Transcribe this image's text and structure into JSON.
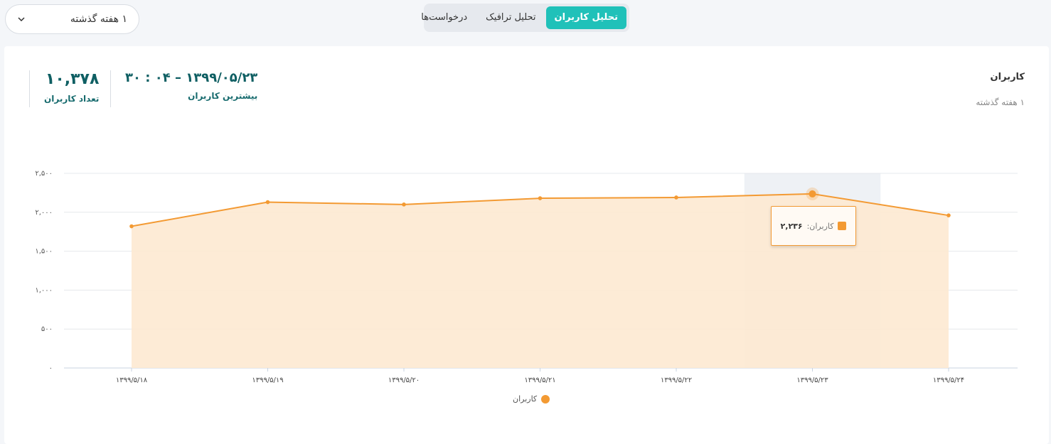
{
  "period_select": {
    "value": "۱ هفته گذشته"
  },
  "tabs": [
    {
      "label": "تحلیل کاربران",
      "active": true
    },
    {
      "label": "تحلیل ترافیک",
      "active": false
    },
    {
      "label": "درخواست‌ها",
      "active": false
    }
  ],
  "card": {
    "title": "کاربران",
    "subtitle": "۱ هفته گذشته",
    "peak": {
      "value": "۱۳۹۹/۰۵/۲۳ – ۰۴ : ۳۰",
      "label": "بیشترین کاربران"
    },
    "total": {
      "value": "۱۰,۳۷۸",
      "label": "تعداد کاربران"
    }
  },
  "tooltip": {
    "name": "کاربران:",
    "value": "۲,۲۳۶"
  },
  "colors": {
    "accent": "#20c1b9",
    "series": "#f39a33",
    "area": "#fde9d2",
    "highlight": "#eef1f5"
  },
  "chart_data": {
    "type": "area",
    "categories": [
      "۱۳۹۹/۵/۱۸",
      "۱۳۹۹/۵/۱۹",
      "۱۳۹۹/۵/۲۰",
      "۱۳۹۹/۵/۲۱",
      "۱۳۹۹/۵/۲۲",
      "۱۳۹۹/۵/۲۳",
      "۱۳۹۹/۵/۲۴"
    ],
    "series": [
      {
        "name": "کاربران",
        "values": [
          1820,
          2130,
          2100,
          2180,
          2190,
          2236,
          1960
        ]
      }
    ],
    "yticks": [
      0,
      500,
      1000,
      1500,
      2000,
      2500
    ],
    "ytick_labels": [
      "۰",
      "۵۰۰",
      "۱,۰۰۰",
      "۱,۵۰۰",
      "۲,۰۰۰",
      "۲,۵۰۰"
    ],
    "ylim": [
      0,
      2500
    ],
    "highlighted_category": "۱۳۹۹/۵/۲۳",
    "grid": true,
    "legend": "bottom-center"
  }
}
